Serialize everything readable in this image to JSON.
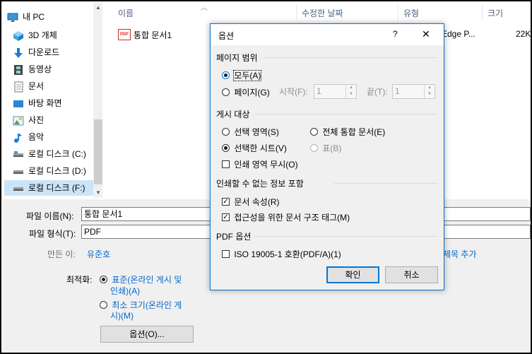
{
  "sidebar": {
    "items": [
      {
        "label": "내 PC",
        "icon": "monitor-icon"
      },
      {
        "label": "3D 개체",
        "icon": "cube-icon"
      },
      {
        "label": "다운로드",
        "icon": "download-icon"
      },
      {
        "label": "동영상",
        "icon": "film-icon"
      },
      {
        "label": "문서",
        "icon": "document-icon"
      },
      {
        "label": "바탕 화면",
        "icon": "desktop-icon"
      },
      {
        "label": "사진",
        "icon": "picture-icon"
      },
      {
        "label": "음악",
        "icon": "music-icon"
      },
      {
        "label": "로컬 디스크 (C:)",
        "icon": "drive-icon"
      },
      {
        "label": "로컬 디스크 (D:)",
        "icon": "drive-icon"
      },
      {
        "label": "로컬 디스크 (F:)",
        "icon": "drive-icon"
      }
    ]
  },
  "filelist": {
    "columns": {
      "name": "이름",
      "modified": "수정한 날짜",
      "type": "유형",
      "size": "크기"
    },
    "rows": [
      {
        "name": "통합 문서1",
        "type": "Edge P...",
        "size": "22K",
        "icon_text": "PDF"
      }
    ]
  },
  "save": {
    "filename_label": "파일 이름(N):",
    "filename_value": "통합 문서1",
    "filetype_label": "파일 형식(T):",
    "filetype_value": "PDF",
    "author_label": "만든 이:",
    "author_value": "유준호",
    "tags_link": "제목 추가",
    "optimize_label": "최적화:",
    "optimize_standard": "표준(온라인 게시 및",
    "optimize_standard_2": "인쇄)(A)",
    "optimize_min": "최소 크기(온라인 게",
    "optimize_min_2": "시)(M)",
    "options_button": "옵션(O)..."
  },
  "dialog": {
    "title": "옵션",
    "help": "?",
    "close": "✕",
    "page_range": {
      "title": "페이지 범위",
      "all": "모두(A)",
      "pages": "페이지(G)",
      "start_label": "시작(F):",
      "start_value": "1",
      "end_label": "끝(T):",
      "end_value": "1"
    },
    "publish": {
      "title": "게시 대상",
      "selection": "선택 영역(S)",
      "workbook": "전체 통합 문서(E)",
      "active_sheets": "선택한 시트(V)",
      "table": "표(B)",
      "ignore_print_areas": "인쇄 영역 무시(O)"
    },
    "nonprint": {
      "title": "인쇄할 수 없는 정보 포함",
      "doc_properties": "문서 속성(R)",
      "structure_tags": "접근성을 위한 문서 구조 태그(M)"
    },
    "pdf": {
      "title": "PDF 옵션",
      "iso": "ISO 19005-1 호환(PDF/A)(1)"
    },
    "ok": "확인",
    "cancel": "취소"
  },
  "colors": {
    "accent": "#0078d7",
    "link": "#0066cc",
    "pdf_red": "#d9261c"
  }
}
